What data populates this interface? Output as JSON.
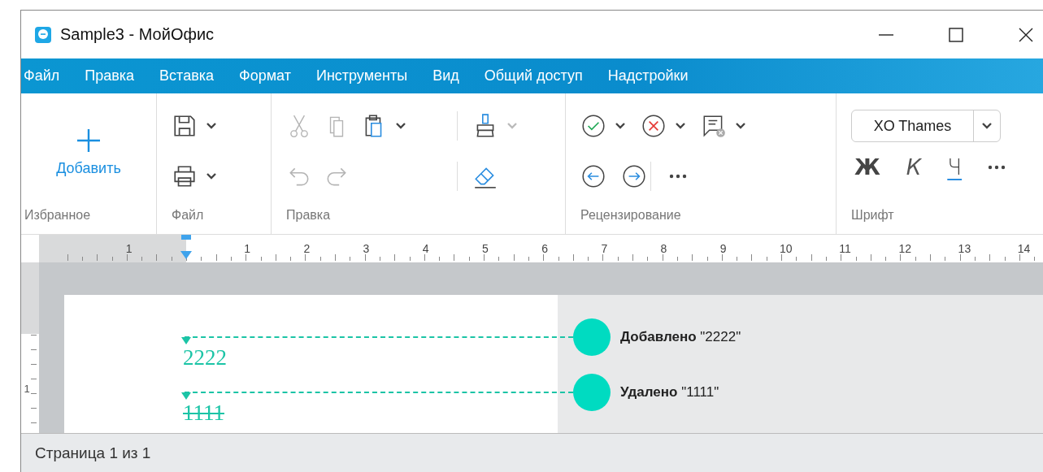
{
  "window": {
    "title": "Sample3 - МойОфис"
  },
  "menu": [
    {
      "label": "Файл"
    },
    {
      "label": "Правка"
    },
    {
      "label": "Вставка"
    },
    {
      "label": "Формат"
    },
    {
      "label": "Инструменты"
    },
    {
      "label": "Вид"
    },
    {
      "label": "Общий доступ"
    },
    {
      "label": "Надстройки"
    }
  ],
  "ribbon": [
    {
      "kind": "favorites",
      "label": "Избранное",
      "add_label": "Добавить"
    },
    {
      "kind": "tools",
      "label": "Файл",
      "rows": [
        [
          [
            {
              "kind": "save",
              "disabled": false,
              "dropdown": true,
              "dropdown_disabled": false
            }
          ]
        ],
        [
          [
            {
              "kind": "print",
              "disabled": false,
              "dropdown": true,
              "dropdown_disabled": false
            }
          ]
        ]
      ]
    },
    {
      "kind": "tools",
      "label": "Правка",
      "rows": [
        [
          [
            {
              "kind": "cut",
              "disabled": true,
              "dropdown": false
            },
            {
              "kind": "copy",
              "disabled": true,
              "dropdown": false
            },
            {
              "kind": "paste",
              "disabled": false,
              "dropdown": true,
              "dropdown_disabled": false
            }
          ],
          [
            {
              "kind": "brush",
              "disabled": false,
              "dropdown": true,
              "dropdown_disabled": true
            }
          ]
        ],
        [
          [
            {
              "kind": "undo",
              "disabled": true,
              "dropdown": false
            },
            {
              "kind": "redo",
              "disabled": true,
              "dropdown": false
            }
          ],
          [
            {
              "kind": "eraser",
              "disabled": false,
              "dropdown": false
            }
          ]
        ]
      ]
    },
    {
      "kind": "tools",
      "label": "Рецензирование",
      "rows": [
        [
          [
            {
              "kind": "accept",
              "disabled": false,
              "dropdown": true,
              "dropdown_disabled": false
            },
            {
              "kind": "reject",
              "disabled": false,
              "dropdown": true,
              "dropdown_disabled": false
            },
            {
              "kind": "comment",
              "disabled": false,
              "dropdown": true,
              "dropdown_disabled": false
            }
          ]
        ],
        [
          [
            {
              "kind": "prev",
              "disabled": false,
              "dropdown": false
            },
            {
              "kind": "next",
              "disabled": false,
              "dropdown": false
            }
          ],
          [
            {
              "kind": "more",
              "disabled": false,
              "dropdown": false
            }
          ]
        ]
      ]
    },
    {
      "kind": "font",
      "label": "Шрифт",
      "font": "XO Thames",
      "styles": [
        {
          "kind": "bold",
          "text": "Ж"
        },
        {
          "kind": "italic",
          "text": "К"
        },
        {
          "kind": "underline",
          "text": "Ч"
        }
      ]
    }
  ],
  "ruler": {
    "labels": [
      "1",
      "1",
      "2",
      "3",
      "4",
      "5",
      "6",
      "7",
      "8",
      "9",
      "10",
      "11",
      "12",
      "13",
      "14"
    ]
  },
  "vertical_ruler": {
    "labels": [
      "1"
    ]
  },
  "changes": [
    {
      "kind": "insert",
      "text": "2222",
      "action": "Добавлено",
      "quote": "\"2222\""
    },
    {
      "kind": "delete",
      "text": "1111",
      "action": "Удалено",
      "quote": "\"1111\""
    }
  ],
  "status_bar": {
    "text": "Страница 1 из 1"
  }
}
